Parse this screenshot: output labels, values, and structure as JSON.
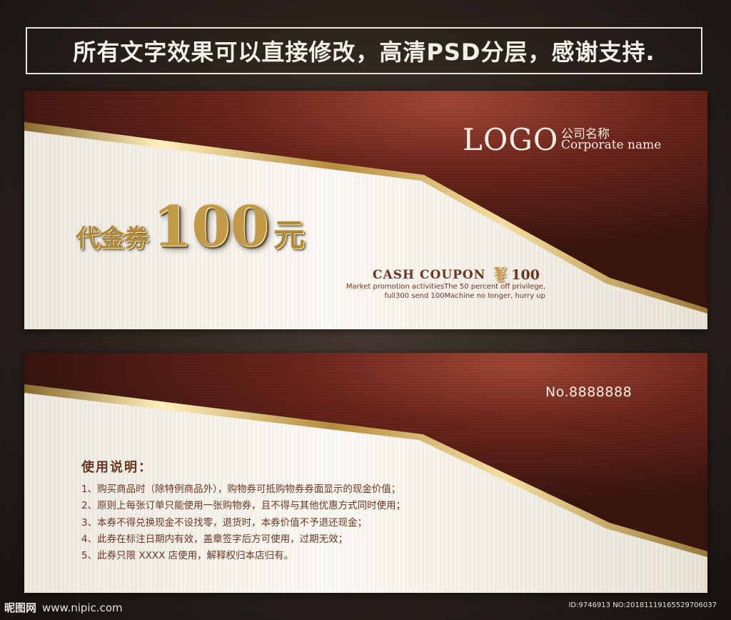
{
  "banner": {
    "text": "所有文字效果可以直接修改，高清PSD分层，感谢支持."
  },
  "front": {
    "logo": "LOGO",
    "company_cn": "公司名称",
    "company_en": "Corporate name",
    "voucher_prefix": "代金券",
    "voucher_amount": "100",
    "voucher_unit": "元",
    "cash_label": "CASH COUPON",
    "currency_symbol": "¥",
    "cash_amount": "100",
    "promo_line1": "Market promotion activitiesThe 50 percent off privilege,",
    "promo_line2": "full300 send 100Machine no longer, hurry up"
  },
  "back": {
    "serial": "No.8888888",
    "usage_title": "使用说明：",
    "rules": [
      "1、购买商品时（除特例商品外），购物券可抵购物券券面显示的现金价值；",
      "2、原则上每张订单只能使用一张购物券，且不得与其他优惠方式同时使用；",
      "3、本券不得兑换现金不设找零，退货时，本券价值不予退还现金；",
      "4、此券在标注日期内有效，盖章签字后方可使用，过期无效；",
      "5、此券只限 XXXX 店使用，解释权归本店归有。"
    ]
  },
  "watermark": {
    "site": "昵图网",
    "url": "www.nipic.com",
    "id_text": "ID:9746913 NO:20181119165529706037"
  },
  "colors": {
    "maroon_dark": "#3f1712",
    "maroon_light": "#8c3a2c",
    "gold": "#d6b36a",
    "cream": "#f3efe6",
    "text_brown": "#6b3523"
  },
  "icons": [
    "yen-icon"
  ]
}
